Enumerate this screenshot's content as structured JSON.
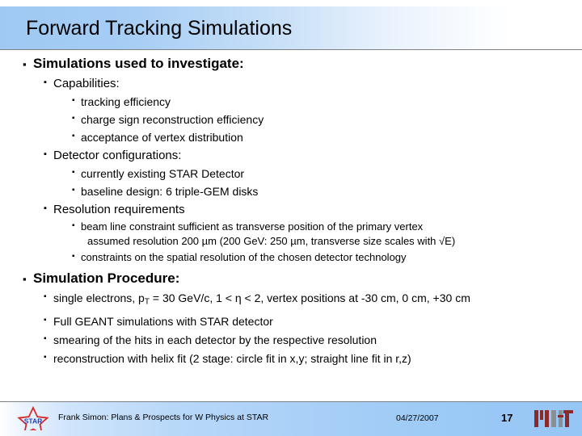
{
  "slide": {
    "title": "Forward Tracking Simulations",
    "title_gradient_start": "#9fc9f3",
    "title_gradient_end": "#ffffff",
    "rule_color": "#808080"
  },
  "bullets": {
    "b1": "Simulations used to investigate:",
    "b2": "Capabilities:",
    "b3": "tracking efficiency",
    "b4": "charge sign reconstruction efficiency",
    "b5": "acceptance of vertex distribution",
    "b6": "Detector configurations:",
    "b7": "currently existing STAR Detector",
    "b8": "baseline design: 6 triple-GEM disks",
    "b9": "Resolution requirements",
    "b10_line1": "beam line constraint sufficient as transverse position of the primary vertex",
    "b10_line2": "assumed resolution 200 µm (200 GeV: 250 µm, transverse size scales with √E)",
    "b11": "constraints on the spatial resolution of the chosen detector technology",
    "b12": "Simulation Procedure:",
    "b13_pre": "single electrons, p",
    "b13_sub": "T",
    "b13_post": " = 30 GeV/c, 1 < η < 2, vertex positions at -30 cm, 0 cm, +30 cm",
    "b14": "Full GEANT simulations with STAR detector",
    "b15": "smearing of the hits in each detector by the respective resolution",
    "b16": "reconstruction with helix fit (2 stage: circle fit in x,y; straight line fit in r,z)",
    "marker_glyph": "▪"
  },
  "footer": {
    "author_line": "Frank Simon: Plans & Prospects for W Physics at STAR",
    "date": "04/27/2007",
    "page_number": "17",
    "star_logo_label": "STAR",
    "star_outline_color": "#d42a2a",
    "star_text_color": "#1f3fb5",
    "mit_color_primary": "#8c2a2a",
    "mit_color_secondary": "#8a8f94",
    "background_start": "#ffffff",
    "background_end": "#96c6f5"
  }
}
